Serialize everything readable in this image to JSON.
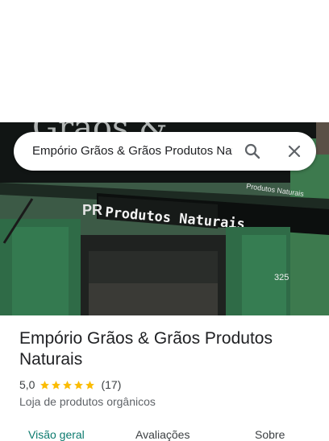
{
  "search": {
    "query": "Empório Grãos & Grãos Produtos Naturais",
    "search_icon": "search-icon",
    "clear_icon": "close-icon"
  },
  "photo": {
    "sign_text": "Produtos Naturais",
    "sign_text_prefix": "PR",
    "banner_top_text": "Grãos &",
    "banner_small_text": "Produtos Naturais",
    "house_number": "325"
  },
  "place": {
    "name": "Empório Grãos & Grãos Produtos Naturais",
    "rating": "5,0",
    "stars": 5,
    "review_count": "(17)",
    "category": "Loja de produtos orgânicos"
  },
  "tabs": [
    {
      "label": "Visão geral",
      "active": true
    },
    {
      "label": "Avaliações",
      "active": false
    },
    {
      "label": "Sobre",
      "active": false
    }
  ],
  "colors": {
    "accent": "#0b7a6e",
    "star": "#fbbc04",
    "storefront_green": "#2f6b47"
  }
}
